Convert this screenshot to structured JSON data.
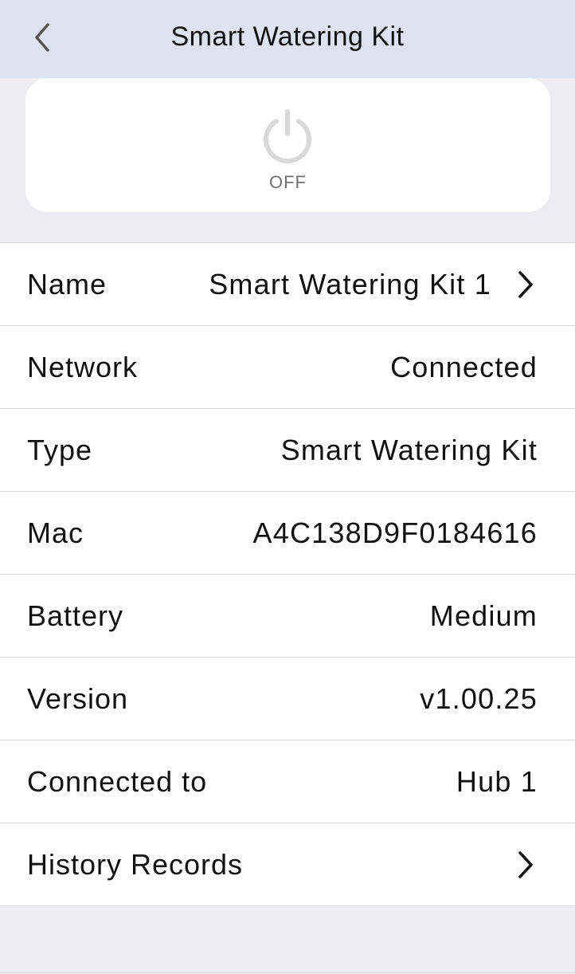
{
  "header": {
    "title": "Smart Watering Kit",
    "back_icon": "chevron-left-icon"
  },
  "power": {
    "icon": "power-icon",
    "status": "OFF"
  },
  "details": [
    {
      "label": "Name",
      "value": "Smart Watering Kit  1",
      "chevron": true
    },
    {
      "label": "Network",
      "value": "Connected",
      "chevron": false
    },
    {
      "label": "Type",
      "value": "Smart Watering Kit",
      "chevron": false
    },
    {
      "label": "Mac",
      "value": "A4C138D9F0184616",
      "chevron": false
    },
    {
      "label": "Battery",
      "value": "Medium",
      "chevron": false
    },
    {
      "label": "Version",
      "value": "v1.00.25",
      "chevron": false
    },
    {
      "label": "Connected to",
      "value": "Hub 1",
      "chevron": false
    },
    {
      "label": "History Records",
      "value": "",
      "chevron": true
    }
  ],
  "colors": {
    "header_bg": "#dde3f1",
    "page_bg": "#edecf2",
    "power_icon": "#d9d9d9",
    "status_text": "#707070"
  }
}
